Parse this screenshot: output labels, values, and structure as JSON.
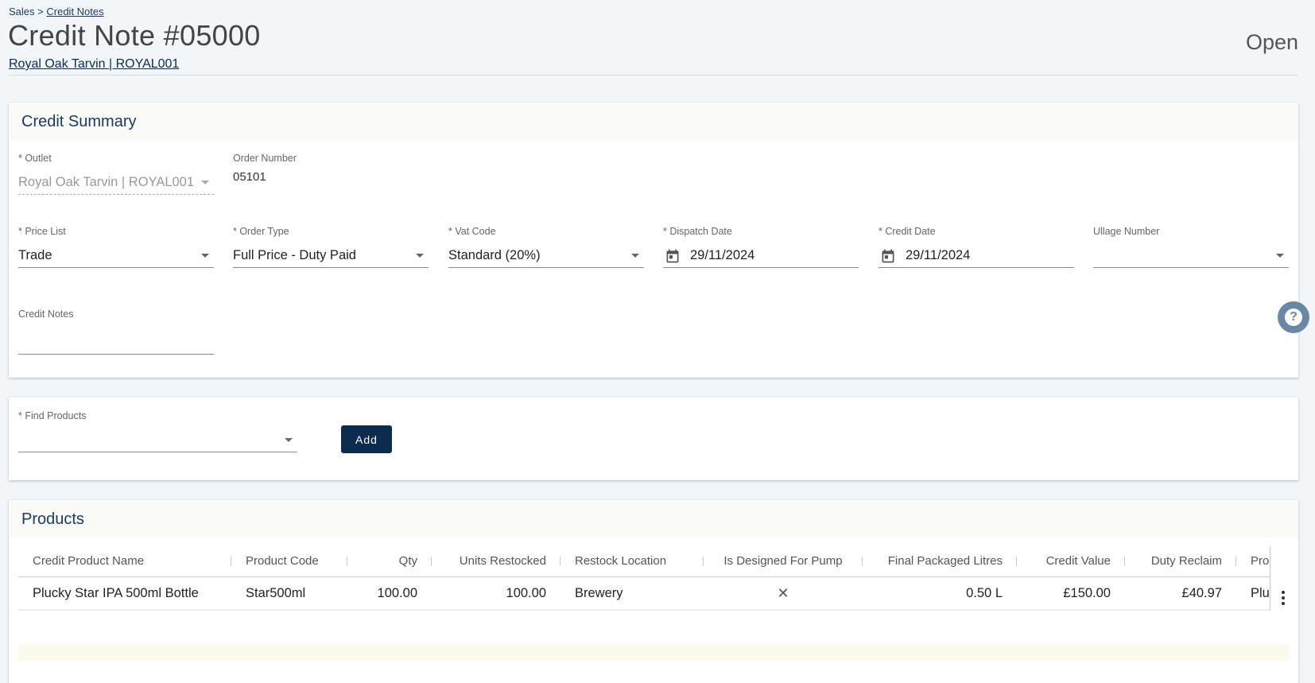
{
  "breadcrumb": {
    "root": "Sales",
    "separator": ">",
    "current": "Credit Notes"
  },
  "page": {
    "title": "Credit Note #05000",
    "outlet_link": "Royal Oak Tarvin | ROYAL001",
    "status": "Open"
  },
  "credit_summary": {
    "title": "Credit Summary",
    "outlet": {
      "label": "* Outlet",
      "value": "Royal Oak Tarvin | ROYAL001"
    },
    "order_number": {
      "label": "Order Number",
      "value": "05101"
    },
    "price_list": {
      "label": "* Price List",
      "value": "Trade"
    },
    "order_type": {
      "label": "* Order Type",
      "value": "Full Price - Duty Paid"
    },
    "vat_code": {
      "label": "* Vat Code",
      "value": "Standard (20%)"
    },
    "dispatch_date": {
      "label": "* Dispatch Date",
      "value": "29/11/2024",
      "icon": "calendar-icon"
    },
    "credit_date": {
      "label": "* Credit Date",
      "value": "29/11/2024",
      "icon": "calendar-icon"
    },
    "ullage_number": {
      "label": "Ullage Number",
      "value": ""
    },
    "credit_notes": {
      "label": "Credit Notes",
      "value": ""
    }
  },
  "find_products": {
    "label": "* Find Products",
    "value": "",
    "add_label": "Add"
  },
  "products": {
    "title": "Products",
    "columns": [
      "Credit Product Name",
      "Product Code",
      "Qty",
      "Units Restocked",
      "Restock Location",
      "Is Designed For Pump",
      "Final Packaged Litres",
      "Credit Value",
      "Duty Reclaim",
      "Pro"
    ],
    "rows": [
      [
        "Plucky Star IPA 500ml Bottle",
        "Star500ml",
        "100.00",
        "100.00",
        "Brewery",
        "✕",
        "0.50 L",
        "£150.00",
        "£40.97",
        "Plu"
      ]
    ]
  },
  "colors": {
    "primary": "#0d2b4e",
    "background": "#f3f6f9",
    "help": "#6a88a6"
  }
}
